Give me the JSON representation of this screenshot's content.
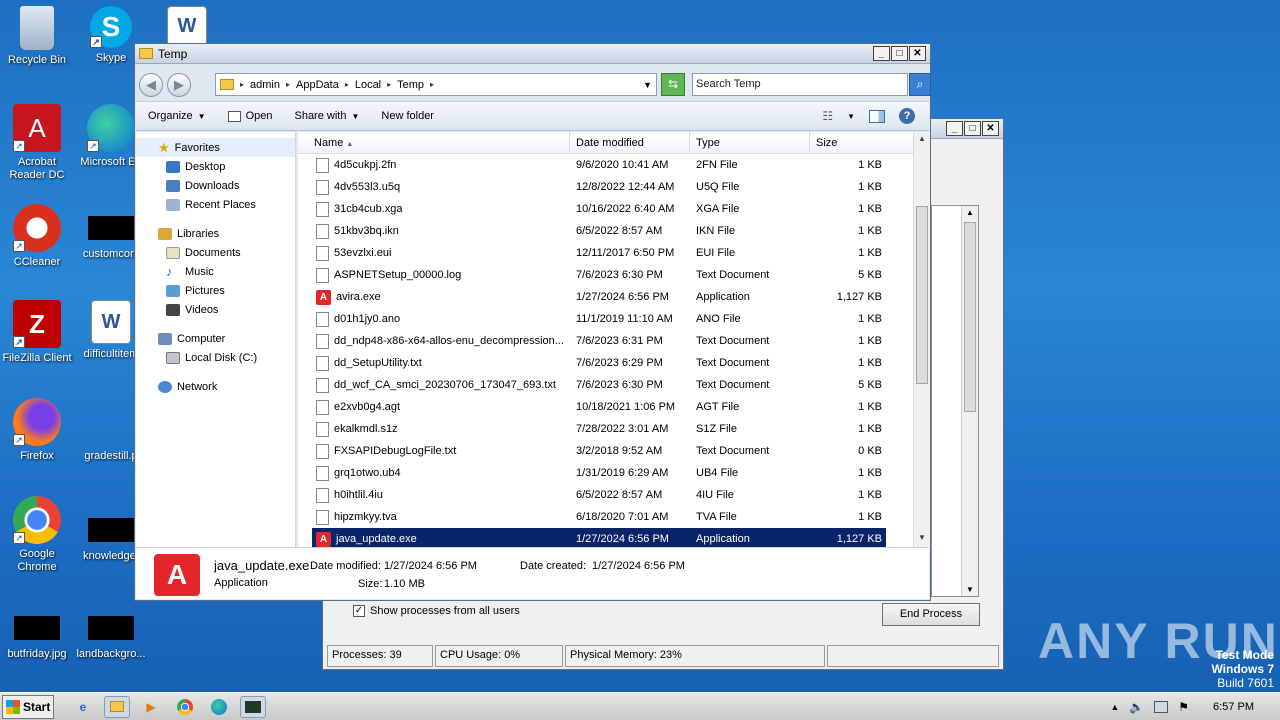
{
  "desktop": {
    "icons": [
      {
        "label": "Recycle Bin",
        "icon": "recycle-bin-icon"
      },
      {
        "label": "Skype",
        "icon": "skype-icon"
      },
      {
        "label": "Acrobat Reader DC",
        "icon": "acrobat-icon"
      },
      {
        "label": "Microsoft Ed",
        "icon": "edge-icon"
      },
      {
        "label": "CCleaner",
        "icon": "ccleaner-icon"
      },
      {
        "label": "customcont",
        "icon": "black-file-icon"
      },
      {
        "label": "FileZilla Client",
        "icon": "filezilla-icon"
      },
      {
        "label": "difficultitem",
        "icon": "word-doc-icon"
      },
      {
        "label": "Firefox",
        "icon": "firefox-icon"
      },
      {
        "label": "gradestill.p",
        "icon": "blank-file-icon"
      },
      {
        "label": "Google Chrome",
        "icon": "chrome-icon"
      },
      {
        "label": "knowledge.",
        "icon": "black-file-icon"
      },
      {
        "label": "butfriday.jpg",
        "icon": "black-file-icon"
      },
      {
        "label": "landbackgro...",
        "icon": "black-file-icon"
      }
    ]
  },
  "explorer": {
    "title": "Temp",
    "breadcrumb": [
      "admin",
      "AppData",
      "Local",
      "Temp"
    ],
    "search_placeholder": "Search Temp",
    "toolbar": {
      "organize": "Organize",
      "open": "Open",
      "share_with": "Share with",
      "new_folder": "New folder"
    },
    "nav": {
      "favorites": "Favorites",
      "desktop": "Desktop",
      "downloads": "Downloads",
      "recent_places": "Recent Places",
      "libraries": "Libraries",
      "documents": "Documents",
      "music": "Music",
      "pictures": "Pictures",
      "videos": "Videos",
      "computer": "Computer",
      "local_disk": "Local Disk (C:)",
      "network": "Network"
    },
    "columns": {
      "name": "Name",
      "date": "Date modified",
      "type": "Type",
      "size": "Size"
    },
    "files": [
      {
        "name": "4d5cukpj.2fn",
        "date": "9/6/2020 10:41 AM",
        "type": "2FN File",
        "size": "1 KB",
        "kind": "file"
      },
      {
        "name": "4dv553l3.u5q",
        "date": "12/8/2022 12:44 AM",
        "type": "U5Q File",
        "size": "1 KB",
        "kind": "file"
      },
      {
        "name": "31cb4cub.xga",
        "date": "10/16/2022 6:40 AM",
        "type": "XGA File",
        "size": "1 KB",
        "kind": "file"
      },
      {
        "name": "51kbv3bq.ikn",
        "date": "6/5/2022 8:57 AM",
        "type": "IKN File",
        "size": "1 KB",
        "kind": "file"
      },
      {
        "name": "53evzlxi.eui",
        "date": "12/11/2017 6:50 PM",
        "type": "EUI File",
        "size": "1 KB",
        "kind": "file"
      },
      {
        "name": "ASPNETSetup_00000.log",
        "date": "7/6/2023 6:30 PM",
        "type": "Text Document",
        "size": "5 KB",
        "kind": "file"
      },
      {
        "name": "avira.exe",
        "date": "1/27/2024 6:56 PM",
        "type": "Application",
        "size": "1,127 KB",
        "kind": "app"
      },
      {
        "name": "d01h1jy0.ano",
        "date": "11/1/2019 11:10 AM",
        "type": "ANO File",
        "size": "1 KB",
        "kind": "file"
      },
      {
        "name": "dd_ndp48-x86-x64-allos-enu_decompression...",
        "date": "7/6/2023 6:31 PM",
        "type": "Text Document",
        "size": "1 KB",
        "kind": "file"
      },
      {
        "name": "dd_SetupUtility.txt",
        "date": "7/6/2023 6:29 PM",
        "type": "Text Document",
        "size": "1 KB",
        "kind": "file"
      },
      {
        "name": "dd_wcf_CA_smci_20230706_173047_693.txt",
        "date": "7/6/2023 6:30 PM",
        "type": "Text Document",
        "size": "5 KB",
        "kind": "file"
      },
      {
        "name": "e2xvb0g4.agt",
        "date": "10/18/2021 1:06 PM",
        "type": "AGT File",
        "size": "1 KB",
        "kind": "file"
      },
      {
        "name": "ekalkmdl.s1z",
        "date": "7/28/2022 3:01 AM",
        "type": "S1Z File",
        "size": "1 KB",
        "kind": "file"
      },
      {
        "name": "FXSAPIDebugLogFile.txt",
        "date": "3/2/2018 9:52 AM",
        "type": "Text Document",
        "size": "0 KB",
        "kind": "file"
      },
      {
        "name": "grq1otwo.ub4",
        "date": "1/31/2019 6:29 AM",
        "type": "UB4 File",
        "size": "1 KB",
        "kind": "file"
      },
      {
        "name": "h0ihtlil.4iu",
        "date": "6/5/2022 8:57 AM",
        "type": "4IU File",
        "size": "1 KB",
        "kind": "file"
      },
      {
        "name": "hipzmkyy.tva",
        "date": "6/18/2020 7:01 AM",
        "type": "TVA File",
        "size": "1 KB",
        "kind": "file"
      },
      {
        "name": "java_update.exe",
        "date": "1/27/2024 6:56 PM",
        "type": "Application",
        "size": "1,127 KB",
        "kind": "app",
        "selected": true
      }
    ],
    "details": {
      "filename": "java_update.exe",
      "type": "Application",
      "date_modified_label": "Date modified:",
      "date_modified": "1/27/2024 6:56 PM",
      "date_created_label": "Date created:",
      "date_created": "1/27/2024 6:56 PM",
      "size_label": "Size:",
      "size": "1.10 MB"
    }
  },
  "taskmgr": {
    "show_all_label": "Show processes from all users",
    "end_process": "End Process",
    "processes": "Processes: 39",
    "cpu": "CPU Usage: 0%",
    "memory": "Physical Memory: 23%"
  },
  "taskbar": {
    "start": "Start",
    "time": "6:57 PM"
  },
  "overlay": {
    "watermark": "ANY RUN",
    "test_mode": "Test Mode",
    "os": "Windows 7",
    "build": "Build 7601"
  }
}
